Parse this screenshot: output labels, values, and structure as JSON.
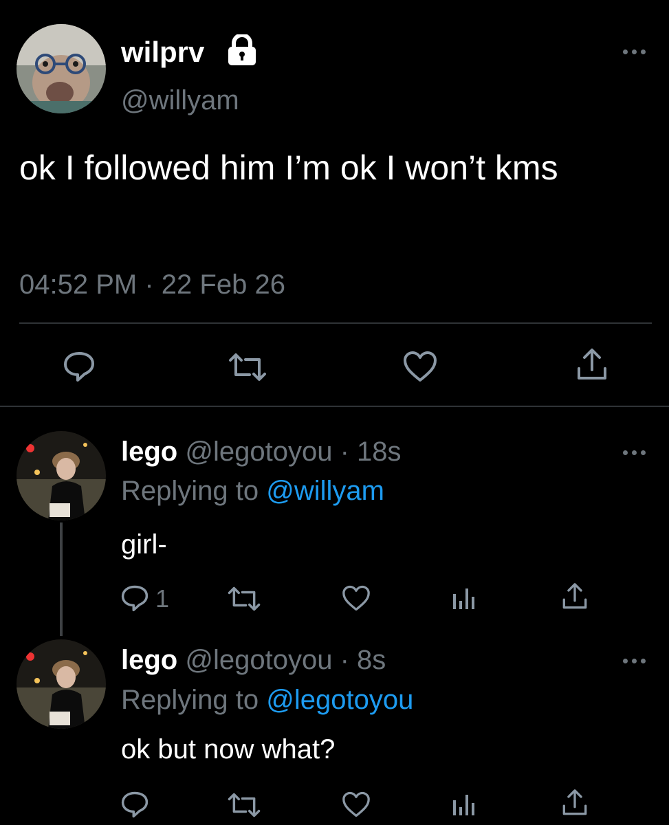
{
  "main_tweet": {
    "display_name": "wilprv",
    "handle": "@willyam",
    "text": "ok I followed him I’m ok I won’t kms",
    "time": "04:52 PM",
    "separator": "·",
    "date": "22 Feb 26",
    "icons": [
      "lock-icon",
      "more-icon",
      "reply-icon",
      "retweet-icon",
      "like-icon",
      "share-icon"
    ]
  },
  "replies": [
    {
      "display_name": "lego",
      "handle": "@legotoyou",
      "separator": "·",
      "age": "18s",
      "replying_prefix": "Replying to",
      "replying_to": "@willyam",
      "text": "girl-",
      "reply_count": "1"
    },
    {
      "display_name": "lego",
      "handle": "@legotoyou",
      "separator": "·",
      "age": "8s",
      "replying_prefix": "Replying to",
      "replying_to": "@legotoyou",
      "text": "ok but now what?",
      "reply_count": ""
    }
  ],
  "colors": {
    "background": "#000000",
    "text": "#ffffff",
    "secondary": "#6e767d",
    "link": "#1d9bf0",
    "divider": "#2f3336"
  }
}
